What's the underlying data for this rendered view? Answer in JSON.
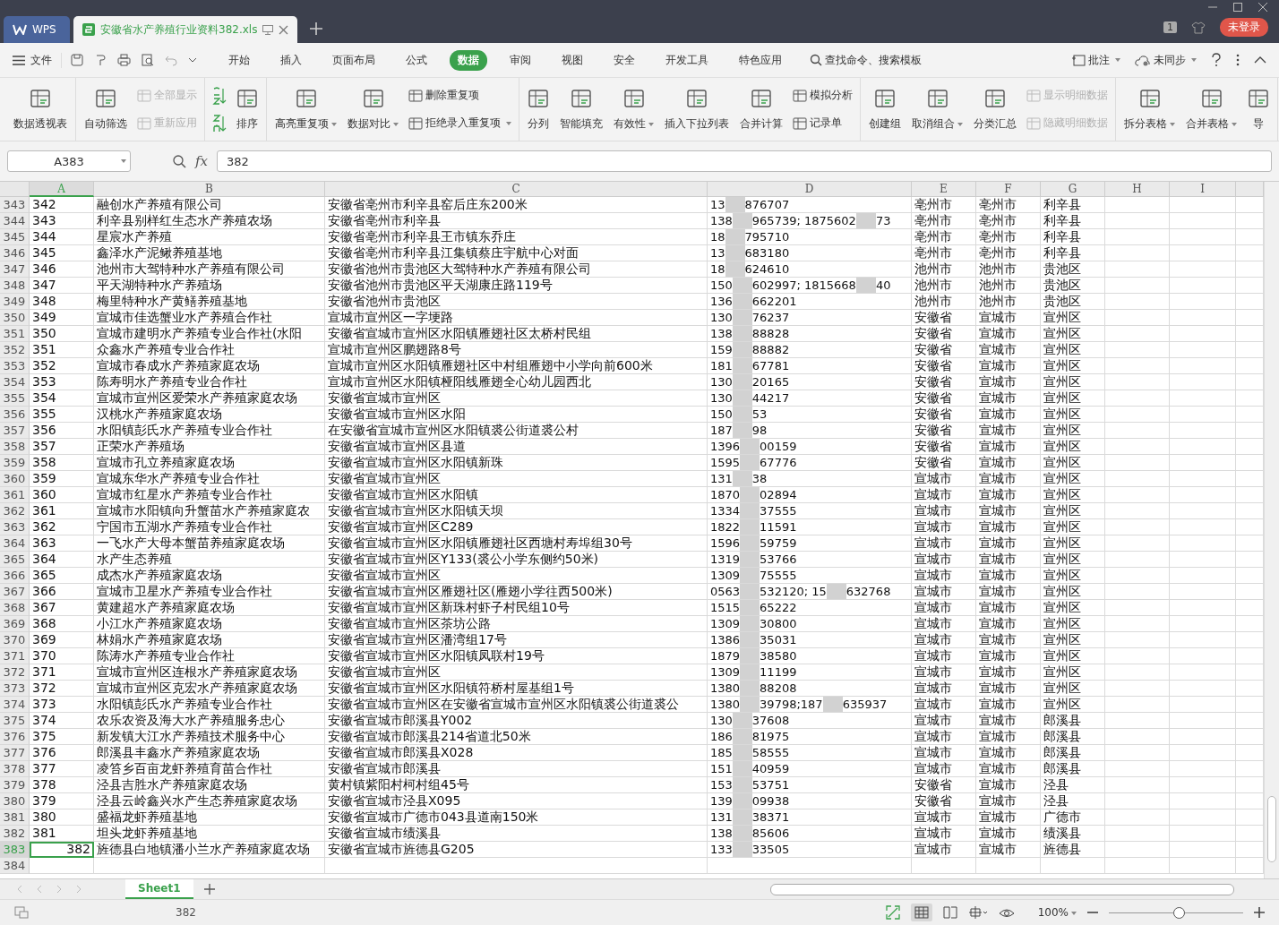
{
  "title_tabs": [
    {
      "label": "WPS",
      "kind": "home",
      "selected": false
    },
    {
      "label": "安徽省水产养殖行业资料382.xls",
      "kind": "doc",
      "selected": true
    }
  ],
  "account": {
    "badge": "1",
    "login": "未登录"
  },
  "menu": {
    "file": "文件",
    "tabs": [
      {
        "label": "开始",
        "selected": false
      },
      {
        "label": "插入",
        "selected": false
      },
      {
        "label": "页面布局",
        "selected": false
      },
      {
        "label": "公式",
        "selected": false
      },
      {
        "label": "数据",
        "selected": true
      },
      {
        "label": "审阅",
        "selected": false
      },
      {
        "label": "视图",
        "selected": false
      },
      {
        "label": "安全",
        "selected": false
      },
      {
        "label": "开发工具",
        "selected": false
      },
      {
        "label": "特色应用",
        "selected": false
      }
    ],
    "search": "查找命令、搜索模板",
    "comment": "批注",
    "sync": "未同步"
  },
  "ribbon": [
    [
      {
        "kind": "large",
        "items": [
          {
            "label": "数据透视表",
            "dropdown": false,
            "disabled": false
          }
        ]
      }
    ],
    [
      {
        "kind": "large",
        "items": [
          {
            "label": "自动筛选",
            "dropdown": false,
            "disabled": false
          }
        ]
      },
      {
        "kind": "stack",
        "items": [
          {
            "label": "全部显示",
            "dropdown": false,
            "disabled": true
          },
          {
            "label": "重新应用",
            "dropdown": false,
            "disabled": true
          }
        ]
      }
    ],
    [
      {
        "kind": "sort"
      },
      {
        "kind": "large",
        "items": [
          {
            "label": "排序",
            "dropdown": false,
            "disabled": false
          }
        ]
      }
    ],
    [
      {
        "kind": "large",
        "items": [
          {
            "label": "高亮重复项",
            "dropdown": true,
            "disabled": false
          }
        ]
      },
      {
        "kind": "large",
        "items": [
          {
            "label": "数据对比",
            "dropdown": true,
            "disabled": false
          }
        ]
      },
      {
        "kind": "stack",
        "items": [
          {
            "label": "删除重复项",
            "dropdown": false,
            "disabled": false
          },
          {
            "label": "拒绝录入重复项",
            "dropdown": true,
            "disabled": false
          }
        ]
      }
    ],
    [
      {
        "kind": "large",
        "items": [
          {
            "label": "分列",
            "dropdown": false,
            "disabled": false
          }
        ]
      },
      {
        "kind": "large",
        "items": [
          {
            "label": "智能填充",
            "dropdown": false,
            "disabled": false
          }
        ]
      },
      {
        "kind": "large",
        "items": [
          {
            "label": "有效性",
            "dropdown": true,
            "disabled": false
          }
        ]
      },
      {
        "kind": "large",
        "items": [
          {
            "label": "插入下拉列表",
            "dropdown": false,
            "disabled": false
          }
        ]
      },
      {
        "kind": "large",
        "items": [
          {
            "label": "合并计算",
            "dropdown": false,
            "disabled": false
          }
        ]
      },
      {
        "kind": "stack",
        "items": [
          {
            "label": "模拟分析",
            "dropdown": false,
            "disabled": false
          },
          {
            "label": "记录单",
            "dropdown": false,
            "disabled": false
          }
        ]
      }
    ],
    [
      {
        "kind": "large",
        "items": [
          {
            "label": "创建组",
            "dropdown": false,
            "disabled": false
          }
        ]
      },
      {
        "kind": "large",
        "items": [
          {
            "label": "取消组合",
            "dropdown": true,
            "disabled": false
          }
        ]
      },
      {
        "kind": "large",
        "items": [
          {
            "label": "分类汇总",
            "dropdown": false,
            "disabled": false
          }
        ]
      },
      {
        "kind": "stack",
        "items": [
          {
            "label": "显示明细数据",
            "dropdown": false,
            "disabled": true
          },
          {
            "label": "隐藏明细数据",
            "dropdown": false,
            "disabled": true
          }
        ]
      }
    ],
    [
      {
        "kind": "large",
        "items": [
          {
            "label": "拆分表格",
            "dropdown": true,
            "disabled": false
          }
        ]
      },
      {
        "kind": "large",
        "items": [
          {
            "label": "合并表格",
            "dropdown": true,
            "disabled": false
          }
        ]
      },
      {
        "kind": "large",
        "items": [
          {
            "label": "导",
            "dropdown": false,
            "disabled": false
          }
        ]
      }
    ]
  ],
  "formula_bar": {
    "name_box": "A383",
    "fx": "fx",
    "value": "382"
  },
  "columns": [
    {
      "label": "A",
      "selected": true
    },
    {
      "label": "B",
      "selected": false
    },
    {
      "label": "C",
      "selected": false
    },
    {
      "label": "D",
      "selected": false
    },
    {
      "label": "E",
      "selected": false
    },
    {
      "label": "F",
      "selected": false
    },
    {
      "label": "G",
      "selected": false
    },
    {
      "label": "H",
      "selected": false
    },
    {
      "label": "I",
      "selected": false
    }
  ],
  "rows": [
    {
      "num": "343",
      "a": "342",
      "numeric": false,
      "b": "融创水产养殖有限公司",
      "c": "安徽省亳州市利辛县窑后庄东200米",
      "d": [
        "13",
        "876707"
      ],
      "e": "亳州市",
      "f": "亳州市",
      "g": "利辛县",
      "selected": false
    },
    {
      "num": "344",
      "a": "343",
      "numeric": false,
      "b": "利辛县别样红生态水产养殖农场",
      "c": "安徽省亳州市利辛县",
      "d": [
        "138",
        "965739; 1875602",
        "73"
      ],
      "e": "亳州市",
      "f": "亳州市",
      "g": "利辛县",
      "selected": false
    },
    {
      "num": "345",
      "a": "344",
      "numeric": false,
      "b": "星宸水产养殖",
      "c": "安徽省亳州市利辛县王市镇东乔庄",
      "d": [
        "18",
        "795710"
      ],
      "e": "亳州市",
      "f": "亳州市",
      "g": "利辛县",
      "selected": false
    },
    {
      "num": "346",
      "a": "345",
      "numeric": false,
      "b": "鑫泽水产泥鳅养殖基地",
      "c": "安徽省亳州市利辛县江集镇蔡庄宇航中心对面",
      "d": [
        "13",
        "683180"
      ],
      "e": "亳州市",
      "f": "亳州市",
      "g": "利辛县",
      "selected": false
    },
    {
      "num": "347",
      "a": "346",
      "numeric": false,
      "b": "池州市大驾特种水产养殖有限公司",
      "c": "安徽省池州市贵池区大驾特种水产养殖有限公司",
      "d": [
        "18",
        "624610"
      ],
      "e": "池州市",
      "f": "池州市",
      "g": "贵池区",
      "selected": false
    },
    {
      "num": "348",
      "a": "347",
      "numeric": false,
      "b": "平天湖特种水产养殖场",
      "c": "安徽省池州市贵池区平天湖康庄路119号",
      "d": [
        "150",
        "602997; 1815668",
        "40"
      ],
      "e": "池州市",
      "f": "池州市",
      "g": "贵池区",
      "selected": false
    },
    {
      "num": "349",
      "a": "348",
      "numeric": false,
      "b": "梅里特种水产黄鳝养殖基地",
      "c": "安徽省池州市贵池区",
      "d": [
        "136",
        "662201"
      ],
      "e": "池州市",
      "f": "池州市",
      "g": "贵池区",
      "selected": false
    },
    {
      "num": "350",
      "a": "349",
      "numeric": false,
      "b": "宣城市佳选蟹业水产养殖合作社",
      "c": "宣城市宣州区一字埂路",
      "d": [
        "130",
        "76237"
      ],
      "e": "安徽省",
      "f": "宣城市",
      "g": "宣州区",
      "selected": false
    },
    {
      "num": "351",
      "a": "350",
      "numeric": false,
      "b": "宣城市建明水产养殖专业合作社(水阳",
      "c": "安徽省宣城市宣州区水阳镇雁翅社区太桥村民组",
      "d": [
        "138",
        "88828"
      ],
      "e": "安徽省",
      "f": "宣城市",
      "g": "宣州区",
      "selected": false
    },
    {
      "num": "352",
      "a": "351",
      "numeric": false,
      "b": "众鑫水产养殖专业合作社",
      "c": "宣城市宣州区鹏翅路8号",
      "d": [
        "159",
        "88882"
      ],
      "e": "安徽省",
      "f": "宣城市",
      "g": "宣州区",
      "selected": false
    },
    {
      "num": "353",
      "a": "352",
      "numeric": false,
      "b": "宣城市春成水产养殖家庭农场",
      "c": "宣城市宣州区水阳镇雁翅社区中村组雁翅中小学向前600米",
      "d": [
        "181",
        "67781"
      ],
      "e": "安徽省",
      "f": "宣城市",
      "g": "宣州区",
      "selected": false
    },
    {
      "num": "354",
      "a": "353",
      "numeric": false,
      "b": "陈寿明水产养殖专业合作社",
      "c": "宣城市宣州区水阳镇桠阳线雁翅全心幼儿园西北",
      "d": [
        "130",
        "20165"
      ],
      "e": "安徽省",
      "f": "宣城市",
      "g": "宣州区",
      "selected": false
    },
    {
      "num": "355",
      "a": "354",
      "numeric": false,
      "b": "宣城市宣州区爱荣水产养殖家庭农场",
      "c": "安徽省宣城市宣州区",
      "d": [
        "130",
        "44217"
      ],
      "e": "安徽省",
      "f": "宣城市",
      "g": "宣州区",
      "selected": false
    },
    {
      "num": "356",
      "a": "355",
      "numeric": false,
      "b": "汉桃水产养殖家庭农场",
      "c": "安徽省宣城市宣州区水阳",
      "d": [
        "150",
        "53"
      ],
      "e": "安徽省",
      "f": "宣城市",
      "g": "宣州区",
      "selected": false
    },
    {
      "num": "357",
      "a": "356",
      "numeric": false,
      "b": "水阳镇彭氏水产养殖专业合作社",
      "c": "在安徽省宣城市宣州区水阳镇裘公街道裘公村",
      "d": [
        "187",
        "98"
      ],
      "e": "安徽省",
      "f": "宣城市",
      "g": "宣州区",
      "selected": false
    },
    {
      "num": "358",
      "a": "357",
      "numeric": false,
      "b": "正荣水产养殖场",
      "c": "安徽省宣城市宣州区县道",
      "d": [
        "1396",
        "00159"
      ],
      "e": "安徽省",
      "f": "宣城市",
      "g": "宣州区",
      "selected": false
    },
    {
      "num": "359",
      "a": "358",
      "numeric": false,
      "b": "宣城市孔立养殖家庭农场",
      "c": "安徽省宣城市宣州区水阳镇新珠",
      "d": [
        "1595",
        "67776"
      ],
      "e": "安徽省",
      "f": "宣城市",
      "g": "宣州区",
      "selected": false
    },
    {
      "num": "360",
      "a": "359",
      "numeric": false,
      "b": "宣城东华水产养殖专业合作社",
      "c": "安徽省宣城市宣州区",
      "d": [
        "131",
        "38"
      ],
      "e": "宣城市",
      "f": "宣城市",
      "g": "宣州区",
      "selected": false
    },
    {
      "num": "361",
      "a": "360",
      "numeric": false,
      "b": "宣城市红星水产养殖专业合作社",
      "c": "安徽省宣城市宣州区水阳镇",
      "d": [
        "1870",
        "02894"
      ],
      "e": "宣城市",
      "f": "宣城市",
      "g": "宣州区",
      "selected": false
    },
    {
      "num": "362",
      "a": "361",
      "numeric": false,
      "b": "宣城市水阳镇向升蟹苗水产养殖家庭农",
      "c": "安徽省宣城市宣州区水阳镇天坝",
      "d": [
        "1334",
        "37555"
      ],
      "e": "宣城市",
      "f": "宣城市",
      "g": "宣州区",
      "selected": false
    },
    {
      "num": "363",
      "a": "362",
      "numeric": false,
      "b": "宁国市五湖水产养殖专业合作社",
      "c": "安徽省宣城市宣州区C289",
      "d": [
        "1822",
        "11591"
      ],
      "e": "宣城市",
      "f": "宣城市",
      "g": "宣州区",
      "selected": false
    },
    {
      "num": "364",
      "a": "363",
      "numeric": false,
      "b": "一飞水产大母本蟹苗养殖家庭农场",
      "c": "安徽省宣城市宣州区水阳镇雁翅社区西塘村寿埠组30号",
      "d": [
        "1596",
        "59759"
      ],
      "e": "宣城市",
      "f": "宣城市",
      "g": "宣州区",
      "selected": false
    },
    {
      "num": "365",
      "a": "364",
      "numeric": false,
      "b": "水产生态养殖",
      "c": "安徽省宣城市宣州区Y133(裘公小学东侧约50米)",
      "d": [
        "1319",
        "53766"
      ],
      "e": "宣城市",
      "f": "宣城市",
      "g": "宣州区",
      "selected": false
    },
    {
      "num": "366",
      "a": "365",
      "numeric": false,
      "b": "成杰水产养殖家庭农场",
      "c": "安徽省宣城市宣州区",
      "d": [
        "1309",
        "75555"
      ],
      "e": "宣城市",
      "f": "宣城市",
      "g": "宣州区",
      "selected": false
    },
    {
      "num": "367",
      "a": "366",
      "numeric": false,
      "b": "宣城市卫星水产养殖专业合作社",
      "c": "安徽省宣城市宣州区雁翅社区(雁翅小学往西500米)",
      "d": [
        "0563",
        "532120; 15",
        "632768"
      ],
      "e": "宣城市",
      "f": "宣城市",
      "g": "宣州区",
      "selected": false
    },
    {
      "num": "368",
      "a": "367",
      "numeric": false,
      "b": "黄建超水产养殖家庭农场",
      "c": "安徽省宣城市宣州区新珠村虾子村民组10号",
      "d": [
        "1515",
        "65222"
      ],
      "e": "宣城市",
      "f": "宣城市",
      "g": "宣州区",
      "selected": false
    },
    {
      "num": "369",
      "a": "368",
      "numeric": false,
      "b": "小江水产养殖家庭农场",
      "c": "安徽省宣城市宣州区茶坊公路",
      "d": [
        "1309",
        "30800"
      ],
      "e": "宣城市",
      "f": "宣城市",
      "g": "宣州区",
      "selected": false
    },
    {
      "num": "370",
      "a": "369",
      "numeric": false,
      "b": "林娟水产养殖家庭农场",
      "c": "安徽省宣城市宣州区潘湾组17号",
      "d": [
        "1386",
        "35031"
      ],
      "e": "宣城市",
      "f": "宣城市",
      "g": "宣州区",
      "selected": false
    },
    {
      "num": "371",
      "a": "370",
      "numeric": false,
      "b": "陈涛水产养殖专业合作社",
      "c": "安徽省宣城市宣州区水阳镇凤联村19号",
      "d": [
        "1879",
        "38580"
      ],
      "e": "宣城市",
      "f": "宣城市",
      "g": "宣州区",
      "selected": false
    },
    {
      "num": "372",
      "a": "371",
      "numeric": false,
      "b": "宣城市宣州区连根水产养殖家庭农场",
      "c": "安徽省宣城市宣州区",
      "d": [
        "1309",
        "11199"
      ],
      "e": "宣城市",
      "f": "宣城市",
      "g": "宣州区",
      "selected": false
    },
    {
      "num": "373",
      "a": "372",
      "numeric": false,
      "b": "宣城市宣州区克宏水产养殖家庭农场",
      "c": "安徽省宣城市宣州区水阳镇符桥村屋基组1号",
      "d": [
        "1380",
        "88208"
      ],
      "e": "宣城市",
      "f": "宣城市",
      "g": "宣州区",
      "selected": false
    },
    {
      "num": "374",
      "a": "373",
      "numeric": false,
      "b": "水阳镇彭氏水产养殖专业合作社",
      "c": "安徽省宣城市宣州区在安徽省宣城市宣州区水阳镇裘公街道裘公",
      "d": [
        "1380",
        "39798;187",
        "635937"
      ],
      "e": "宣城市",
      "f": "宣城市",
      "g": "宣州区",
      "selected": false
    },
    {
      "num": "375",
      "a": "374",
      "numeric": false,
      "b": "农乐农资及海大水产养殖服务忠心",
      "c": "安徽省宣城市郎溪县Y002",
      "d": [
        "130",
        "37608"
      ],
      "e": "宣城市",
      "f": "宣城市",
      "g": "郎溪县",
      "selected": false
    },
    {
      "num": "376",
      "a": "375",
      "numeric": false,
      "b": "新发镇大江水产养殖技术服务中心",
      "c": "安徽省宣城市郎溪县214省道北50米",
      "d": [
        "186",
        "81975"
      ],
      "e": "宣城市",
      "f": "宣城市",
      "g": "郎溪县",
      "selected": false
    },
    {
      "num": "377",
      "a": "376",
      "numeric": false,
      "b": "郎溪县丰鑫水产养殖家庭农场",
      "c": "安徽省宣城市郎溪县X028",
      "d": [
        "185",
        "58555"
      ],
      "e": "宣城市",
      "f": "宣城市",
      "g": "郎溪县",
      "selected": false
    },
    {
      "num": "378",
      "a": "377",
      "numeric": false,
      "b": "凌笞乡百亩龙虾养殖育苗合作社",
      "c": "安徽省宣城市郎溪县",
      "d": [
        "151",
        "40959"
      ],
      "e": "宣城市",
      "f": "宣城市",
      "g": "郎溪县",
      "selected": false
    },
    {
      "num": "379",
      "a": "378",
      "numeric": false,
      "b": "泾县吉胜水产养殖家庭农场",
      "c": "黄村镇紫阳村柯村组45号",
      "d": [
        "153",
        "53751"
      ],
      "e": "安徽省",
      "f": "宣城市",
      "g": "泾县",
      "selected": false
    },
    {
      "num": "380",
      "a": "379",
      "numeric": false,
      "b": "泾县云岭鑫兴水产生态养殖家庭农场",
      "c": "安徽省宣城市泾县X095",
      "d": [
        "139",
        "09938"
      ],
      "e": "安徽省",
      "f": "宣城市",
      "g": "泾县",
      "selected": false
    },
    {
      "num": "381",
      "a": "380",
      "numeric": false,
      "b": "盛福龙虾养殖基地",
      "c": "安徽省宣城市广德市043县道南150米",
      "d": [
        "131",
        "38371"
      ],
      "e": "宣城市",
      "f": "宣城市",
      "g": "广德市",
      "selected": false
    },
    {
      "num": "382",
      "a": "381",
      "numeric": false,
      "b": "坦头龙虾养殖基地",
      "c": "安徽省宣城市绩溪县",
      "d": [
        "138",
        "85606"
      ],
      "e": "宣城市",
      "f": "宣城市",
      "g": "绩溪县",
      "selected": false
    },
    {
      "num": "383",
      "a": "382",
      "numeric": true,
      "b": "旌德县白地镇潘小兰水产养殖家庭农场",
      "c": "安徽省宣城市旌德县G205",
      "d": [
        "133",
        "33505"
      ],
      "e": "宣城市",
      "f": "宣城市",
      "g": "旌德县",
      "selected": true
    }
  ],
  "empty_rows": [
    "384"
  ],
  "sheet_tabs": [
    {
      "label": "Sheet1",
      "selected": true
    }
  ],
  "status": {
    "value": "382",
    "zoom": "100%",
    "level": 0.52
  }
}
